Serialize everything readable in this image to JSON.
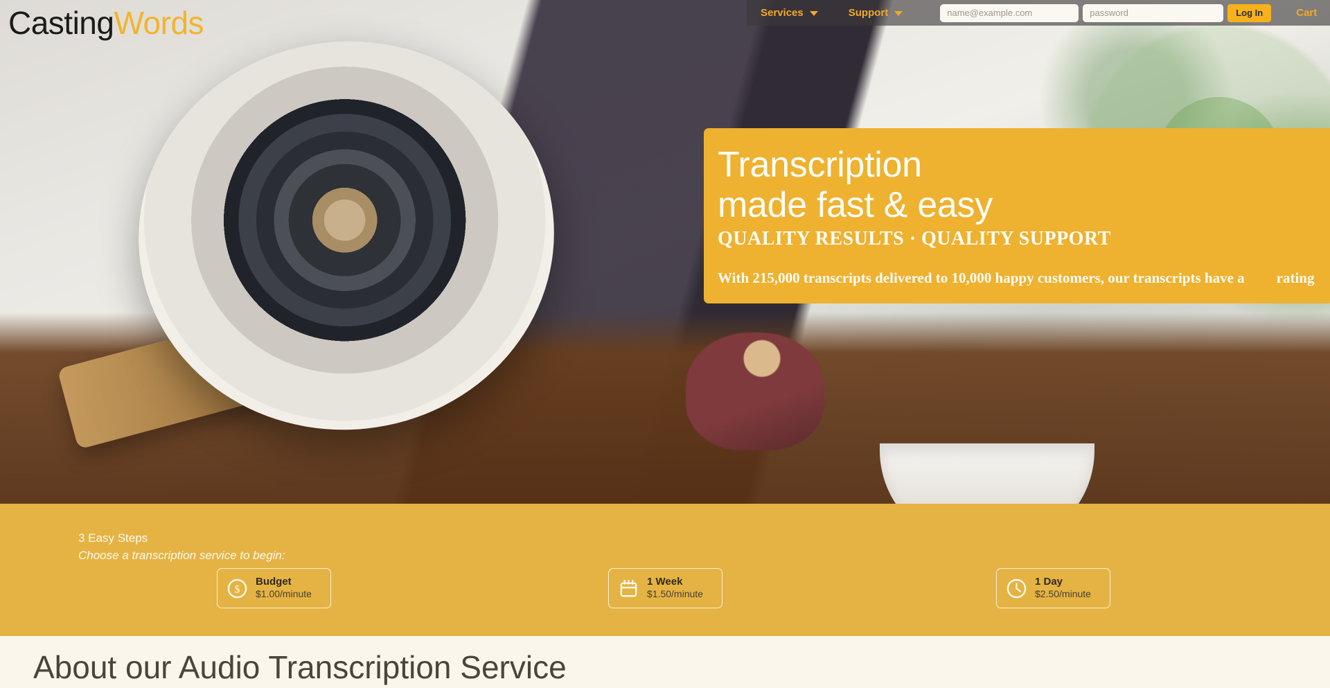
{
  "brand": {
    "name_dark": "Casting",
    "name_accent": "Words",
    "accent_color": "#f2b42e"
  },
  "nav": {
    "services_label": "Services",
    "support_label": "Support",
    "email_placeholder": "name@example.com",
    "password_placeholder": "password",
    "login_label": "Log In",
    "cart_label": "Cart",
    "link_color": "#f2a92a",
    "button_color": "#f6b11d"
  },
  "hero": {
    "headline_line1": "Transcription",
    "headline_line2": "made fast & easy",
    "subhead": "QUALITY RESULTS · QUALITY SUPPORT",
    "blurb_before": "With 215,000 transcripts delivered to 10,000 happy customers, our transcripts have a",
    "blurb_after": "rating",
    "panel_color": "#eeb130",
    "transcripts_delivered": "215,000",
    "happy_customers": "10,000"
  },
  "steps": {
    "title": "3 Easy Steps",
    "subtitle": "Choose a transcription service to begin:",
    "band_color": "#e5b343",
    "options": [
      {
        "icon": "dollar-circle-icon",
        "name": "Budget",
        "price": "$1.00/minute"
      },
      {
        "icon": "calendar-icon",
        "name": "1 Week",
        "price": "$1.50/minute"
      },
      {
        "icon": "clock-icon",
        "name": "1 Day",
        "price": "$2.50/minute"
      }
    ]
  },
  "lower": {
    "heading": "About our Audio Transcription Service"
  }
}
